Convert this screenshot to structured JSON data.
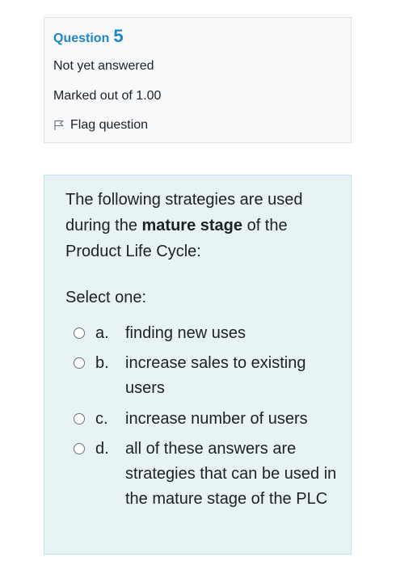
{
  "info": {
    "question_word": "Question",
    "question_number": "5",
    "state": "Not yet answered",
    "grade": "Marked out of 1.00",
    "flag_label": "Flag question"
  },
  "question": {
    "text_before": "The following strategies are used during the ",
    "text_bold": "mature stage",
    "text_after": " of the Product Life Cycle:",
    "prompt": "Select one:",
    "options": [
      {
        "letter": "a.",
        "text": "finding new uses"
      },
      {
        "letter": "b.",
        "text": "increase sales to existing users"
      },
      {
        "letter": "c.",
        "text": "increase number of users"
      },
      {
        "letter": "d.",
        "text": "all of these answers are strategies that can be used in the mature stage of the PLC"
      }
    ]
  },
  "colors": {
    "accent": "#1f86c6",
    "content_bg": "#e7f3f5",
    "info_bg": "#f8f9fa"
  }
}
